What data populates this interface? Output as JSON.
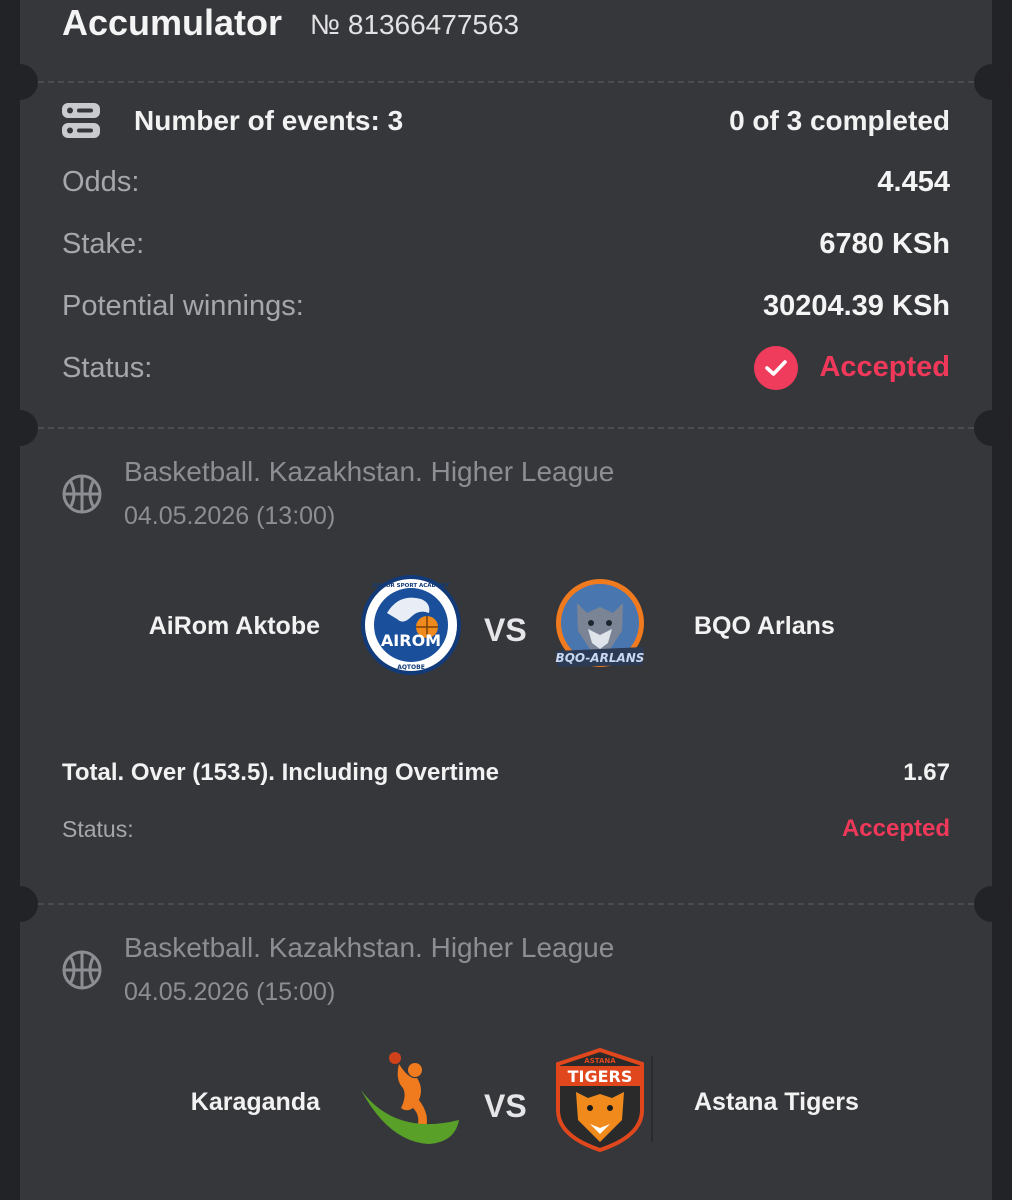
{
  "header": {
    "title": "Accumulator",
    "bet_number": "№ 81366477563"
  },
  "summary": {
    "events_label": "Number of events: 3",
    "completed": "0 of 3 completed",
    "rows": [
      {
        "label": "Odds:",
        "value": "4.454"
      },
      {
        "label": "Stake:",
        "value": "6780 KSh"
      },
      {
        "label": "Potential winnings:",
        "value": "30204.39 KSh"
      }
    ],
    "status_label": "Status:",
    "status_value": "Accepted"
  },
  "events": [
    {
      "league": "Basketball. Kazakhstan. Higher League",
      "datetime": "04.05.2026 (13:00)",
      "team_home": "AiRom Aktobe",
      "team_away": "BQO Arlans",
      "vs": "VS",
      "home_logo": {
        "wordmark": "AIROM",
        "top_text": "JUNIOR SPORT ACADEMY",
        "bottom_text": "AQTOBE",
        "icon": "snow-leopard-logo"
      },
      "away_logo": {
        "wordmark": "BQO-ARLANS",
        "icon": "wolf-logo"
      },
      "market": "Total. Over (153.5). Including Overtime",
      "odds": "1.67",
      "status_label": "Status:",
      "status_value": "Accepted"
    },
    {
      "league": "Basketball. Kazakhstan. Higher League",
      "datetime": "04.05.2026 (15:00)",
      "team_home": "Karaganda",
      "team_away": "Astana Tigers",
      "vs": "VS",
      "home_logo": {
        "icon": "karaganda-player-logo"
      },
      "away_logo": {
        "wordmark": "TIGERS",
        "top_text": "ASTANA",
        "icon": "tiger-logo"
      }
    }
  ],
  "colors": {
    "background": "#222326",
    "card": "#36373b",
    "accent": "#ef3b5c",
    "muted_text": "#a6a7ac"
  }
}
